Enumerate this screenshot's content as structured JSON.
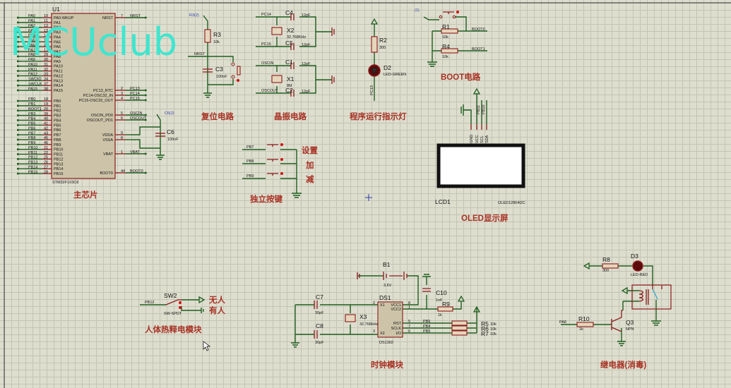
{
  "watermark": "MCUclub",
  "colors": {
    "wire": "#1f5f1f",
    "component": "#8a1c1c",
    "title": "#a83224",
    "watermark": "#3fe6cf"
  },
  "mcu": {
    "ref": "U1",
    "part": "STM32F103C8",
    "title": "主芯片",
    "left_pins": [
      {
        "net": "PA0",
        "num": "10",
        "pin": "PA0-WKUP"
      },
      {
        "net": "PA1",
        "num": "11",
        "pin": "PA1"
      },
      {
        "net": "PA2",
        "num": "12",
        "pin": "PA2"
      },
      {
        "net": "PA3",
        "num": "13",
        "pin": "PA3"
      },
      {
        "net": "PA4",
        "num": "14",
        "pin": "PA4"
      },
      {
        "net": "PA5",
        "num": "15",
        "pin": "PA5"
      },
      {
        "net": "PA6",
        "num": "16",
        "pin": "PA6"
      },
      {
        "net": "PA7",
        "num": "17",
        "pin": "PA7"
      },
      {
        "net": "PA8",
        "num": "29",
        "pin": "PA8"
      },
      {
        "net": "PA9",
        "num": "30",
        "pin": "PA9"
      },
      {
        "net": "PA10",
        "num": "31",
        "pin": "PA10"
      },
      {
        "net": "PA11",
        "num": "32",
        "pin": "PA11"
      },
      {
        "net": "PA12",
        "num": "33",
        "pin": "PA12"
      },
      {
        "net": "SWDIO",
        "num": "34",
        "pin": "PA13"
      },
      {
        "net": "SWCLK",
        "num": "37",
        "pin": "PA14"
      },
      {
        "net": "PA15",
        "num": "38",
        "pin": "PA15"
      },
      {
        "net": "PB0",
        "num": "18",
        "pin": "PB0"
      },
      {
        "net": "PB1",
        "num": "19",
        "pin": "PB1"
      },
      {
        "net": "BOOT1",
        "num": "20",
        "pin": "PB2"
      },
      {
        "net": "PB3",
        "num": "39",
        "pin": "PB3"
      },
      {
        "net": "PB4",
        "num": "40",
        "pin": "PB4"
      },
      {
        "net": "PB5",
        "num": "41",
        "pin": "PB5"
      },
      {
        "net": "PB6",
        "num": "42",
        "pin": "PB6"
      },
      {
        "net": "PB7",
        "num": "43",
        "pin": "PB7"
      },
      {
        "net": "PB8",
        "num": "45",
        "pin": "PB8"
      },
      {
        "net": "PB9",
        "num": "46",
        "pin": "PB9"
      },
      {
        "net": "PB10",
        "num": "21",
        "pin": "PB10"
      },
      {
        "net": "PB11",
        "num": "22",
        "pin": "PB11"
      },
      {
        "net": "PB12",
        "num": "25",
        "pin": "PB12"
      },
      {
        "net": "PB13",
        "num": "26",
        "pin": "PB13"
      },
      {
        "net": "PB14",
        "num": "27",
        "pin": "PB14"
      },
      {
        "net": "PB15",
        "num": "28",
        "pin": "PB15"
      }
    ],
    "right_pins": [
      {
        "net": "NRST",
        "num": "7",
        "pin": "NRST"
      },
      {
        "net": "PC13",
        "num": "2",
        "pin": "PC13_RTC"
      },
      {
        "net": "PC14",
        "num": "3",
        "pin": "PC14-OSC32_IN"
      },
      {
        "net": "PC15",
        "num": "4",
        "pin": "PC15-OSC32_OUT"
      },
      {
        "net": "OSCIN",
        "num": "5",
        "pin": "OSCIN_PD0"
      },
      {
        "net": "OSCOUT",
        "num": "6",
        "pin": "OSCOUT_PD1"
      },
      {
        "net": "",
        "num": "9",
        "pin": "VDDA"
      },
      {
        "net": "",
        "num": "8",
        "pin": "VSSA"
      },
      {
        "net": "VBAT",
        "num": "1",
        "pin": "VBAT"
      },
      {
        "net": "BOOT0",
        "num": "44",
        "pin": "BOOT0"
      }
    ],
    "c6": {
      "ref": "C6",
      "value": "100nF",
      "probe": "C6(2)"
    }
  },
  "reset": {
    "title": "复位电路",
    "probe": "R3(2)",
    "r3": {
      "ref": "R3",
      "value": "10k"
    },
    "c3": {
      "ref": "C3",
      "value": "100nF"
    },
    "net": "NRST"
  },
  "crystal": {
    "title": "晶振电路",
    "x2": {
      "ref": "X2",
      "value": "32.768KHz"
    },
    "x1": {
      "ref": "X1",
      "value": "8M"
    },
    "c4": {
      "ref": "C4",
      "value": "12pF"
    },
    "c5": {
      "ref": "C5",
      "value": "12pF"
    },
    "c1": {
      "ref": "C1",
      "value": "12pF"
    },
    "c2": {
      "ref": "C2",
      "value": "12pF"
    },
    "nets": [
      "PC14",
      "PC15",
      "OSCIN",
      "OSCOUT"
    ]
  },
  "led": {
    "title": "程序运行指示灯",
    "r2": {
      "ref": "R2",
      "value": "300"
    },
    "d2": {
      "ref": "D2",
      "value": "LED-GREEN"
    },
    "net": "PC13"
  },
  "boot": {
    "title": "BOOT电路",
    "probe": "(1)",
    "r1": {
      "ref": "R1",
      "value": "10k"
    },
    "r4": {
      "ref": "R4",
      "value": "10k"
    },
    "nets": [
      "BOOT0",
      "BOOT1"
    ]
  },
  "oled": {
    "title": "OLED显示屏",
    "ref": "LCD1",
    "part": "OLED12864I2C",
    "pins": [
      "GND",
      "VCC",
      "SCL",
      "SDA"
    ],
    "nets": [
      "PB11",
      "PB10"
    ]
  },
  "keys": {
    "title": "独立按键",
    "nets": [
      "PB7",
      "PB8",
      "PB9"
    ],
    "labels": [
      "设置",
      "加",
      "减"
    ]
  },
  "pir": {
    "title": "人体热释电模块",
    "ref": "SW2",
    "part": "SW-SPDT",
    "net": "PB12",
    "labels": [
      "无人",
      "有人"
    ]
  },
  "clock": {
    "title": "时钟模块",
    "b1": {
      "ref": "B1",
      "value": "3.6V"
    },
    "c10": {
      "ref": "C10",
      "value": "1nF"
    },
    "r9": {
      "ref": "R9",
      "value": "1k"
    },
    "c7": {
      "ref": "C7",
      "value": "30pF"
    },
    "c8": {
      "ref": "C8",
      "value": "30pF"
    },
    "x3": {
      "ref": "X3",
      "value": "32.768kHz"
    },
    "ds1": {
      "ref": "DS1",
      "part": "DS1302",
      "pins": [
        "X1",
        "VCC1",
        "VCC2",
        "RST",
        "SCLK",
        "I/O",
        "X2"
      ],
      "nums": [
        "2",
        "8",
        "1",
        "5",
        "7",
        "6",
        "3"
      ]
    },
    "nets": [
      "PB6",
      "PB4",
      "PB5"
    ],
    "res": [
      {
        "ref": "R5",
        "value": "10k"
      },
      {
        "ref": "R6",
        "value": "10k"
      },
      {
        "ref": "R7",
        "value": "10k"
      }
    ]
  },
  "relay": {
    "title": "继电器(消毒)",
    "r8": {
      "ref": "R8",
      "value": "300"
    },
    "d3": {
      "ref": "D3",
      "value": "LED-RED"
    },
    "r10": {
      "ref": "R10",
      "value": "1k"
    },
    "q3": {
      "ref": "Q3",
      "value": "NPN"
    },
    "net": "PA8"
  }
}
